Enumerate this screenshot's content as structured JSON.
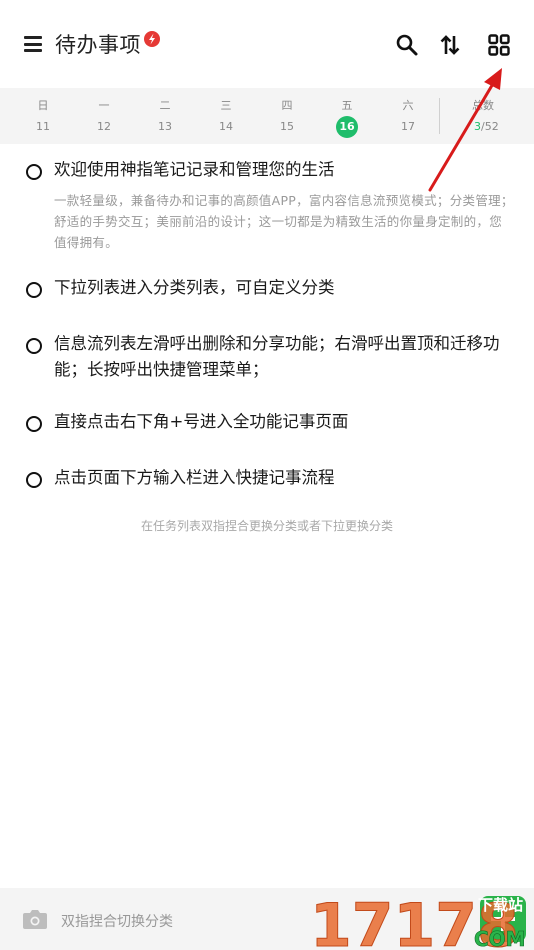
{
  "header": {
    "title": "待办事项",
    "icons": [
      "menu-icon",
      "lightning-icon",
      "search-icon",
      "sort-icon",
      "grid-icon"
    ]
  },
  "week": {
    "days": [
      {
        "weekday": "日",
        "date": "11"
      },
      {
        "weekday": "一",
        "date": "12"
      },
      {
        "weekday": "二",
        "date": "13"
      },
      {
        "weekday": "三",
        "date": "14"
      },
      {
        "weekday": "四",
        "date": "15"
      },
      {
        "weekday": "五",
        "date": "16"
      },
      {
        "weekday": "六",
        "date": "17"
      }
    ],
    "active_date": "16",
    "count_label": "总数",
    "count_done": "3",
    "count_total": "/52"
  },
  "tasks": [
    {
      "title": "欢迎使用神指笔记记录和管理您的生活",
      "desc": "一款轻量级，兼备待办和记事的高颜值APP，富内容信息流预览模式；分类管理；舒适的手势交互；美丽前沿的设计；这一切都是为精致生活的你量身定制的，您值得拥有。"
    },
    {
      "title": "下拉列表进入分类列表，可自定义分类"
    },
    {
      "title": "信息流列表左滑呼出删除和分享功能；右滑呼出置顶和迁移功能；长按呼出快捷管理菜单；"
    },
    {
      "title": "直接点击右下角+号进入全功能记事页面"
    },
    {
      "title": "点击页面下方输入栏进入快捷记事流程"
    }
  ],
  "hint": "在任务列表双指捏合更换分类或者下拉更换分类",
  "bottom_bar": {
    "placeholder": "双指捏合切换分类"
  },
  "watermark": {
    "number": "17178",
    "site_top": "下载站",
    "site_bottom": "COM"
  },
  "colors": {
    "accent": "#1fbd6b",
    "bolt": "#e53935",
    "arrow": "#d81b1b",
    "plus_button": "#2ab34a"
  }
}
